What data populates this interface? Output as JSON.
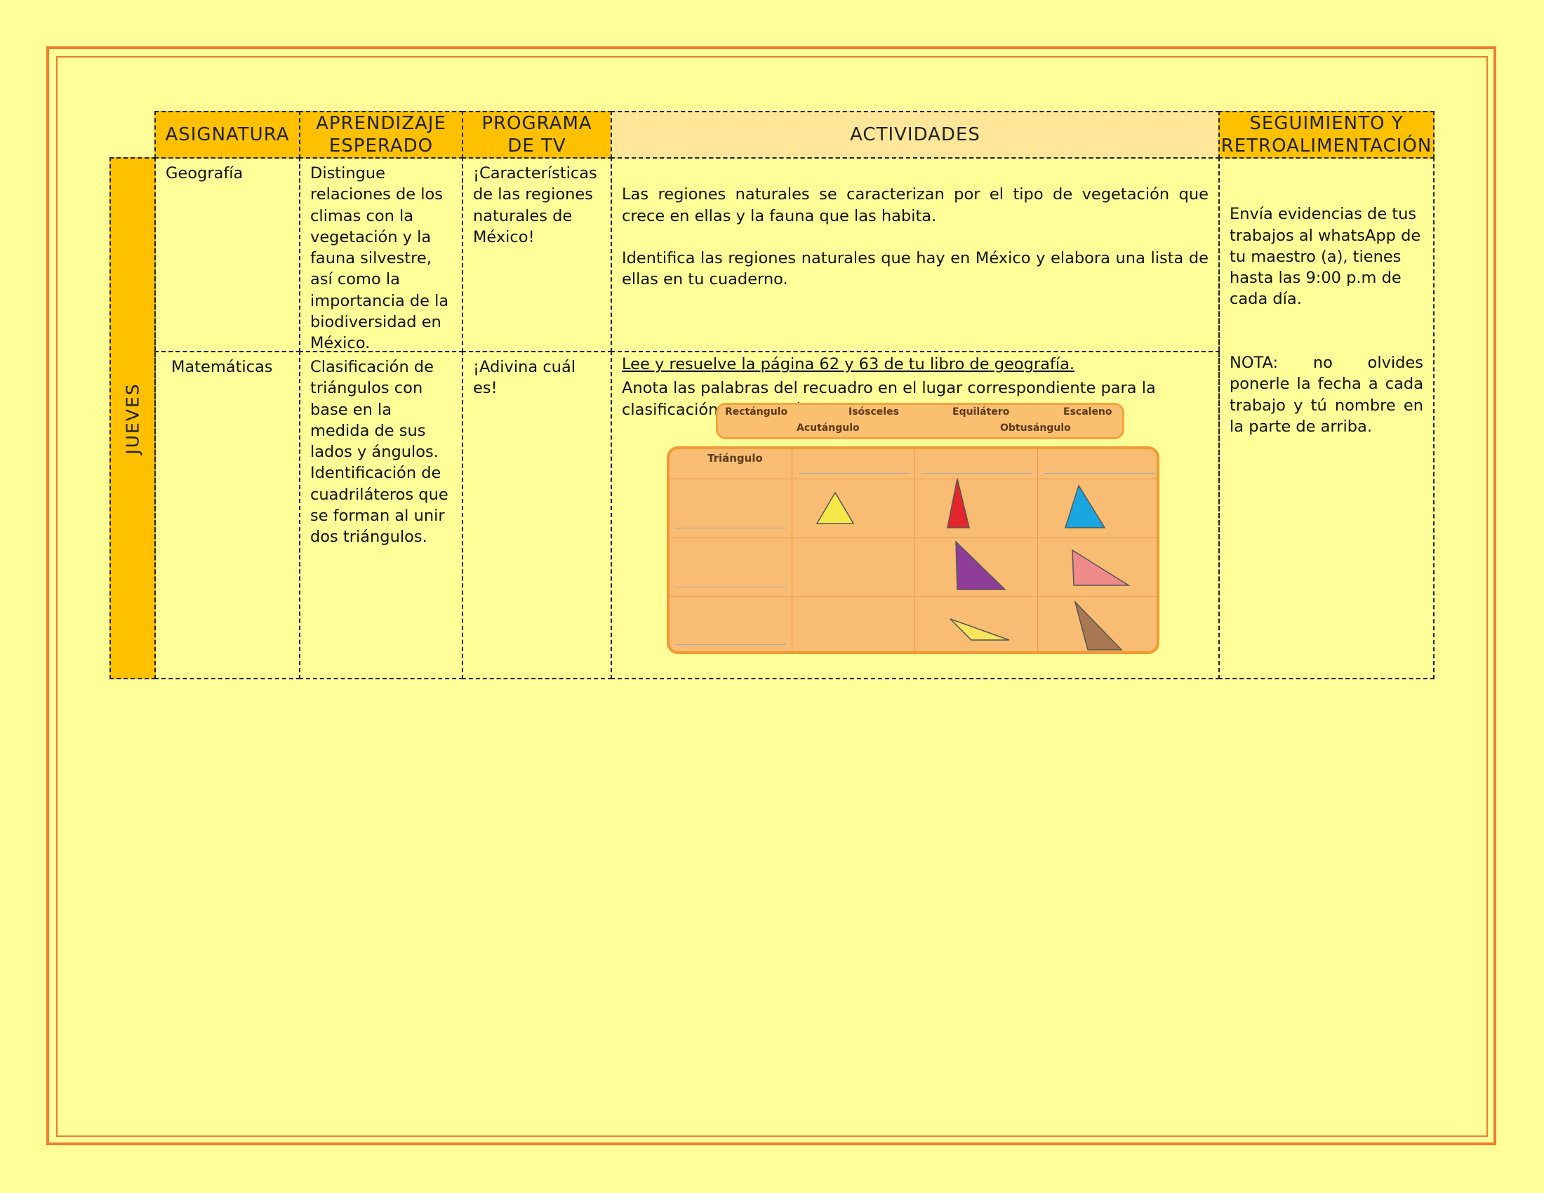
{
  "headers": {
    "asignatura": "ASIGNATURA",
    "aprendizaje": "APRENDIZAJE\nESPERADO",
    "programa": "PROGRAMA\nDE TV",
    "actividades": "ACTIVIDADES",
    "seguimiento": "SEGUIMIENTO Y\nRETROALIMENTACIÓN"
  },
  "day": "JUEVES",
  "rows": [
    {
      "asignatura": "Geografía",
      "aprendizaje": "Distingue relaciones de los climas con la vegetación y la fauna silvestre, así como la importancia de la biodiversidad en México.",
      "programa": "¡Características de las regiones naturales de México!",
      "actividades": {
        "p1": "Las regiones naturales se caracterizan por el tipo de vegetación que crece en ellas y la fauna que las habita.",
        "p2": "Identifica las regiones naturales que hay en México y elabora una lista de ellas en tu cuaderno.",
        "p3": "Lee y resuelve la página 62 y 63 de tu libro de geografía."
      }
    },
    {
      "asignatura": "Matemáticas",
      "aprendizaje": "Clasificación de triángulos con base en la medida de sus lados y ángulos. Identificación de cuadriláteros que se forman al unir dos triángulos.",
      "programa": "¡Adivina cuál es!",
      "actividades": {
        "p1": "Anota las palabras del recuadro en el lugar correspondiente para la clasificación de los triángulos."
      }
    }
  ],
  "seguimiento": {
    "p1": "Envía evidencias de tus trabajos al whatsApp de tu maestro (a), tienes hasta las 9:00 p.m de cada día.",
    "p2": "NOTA: no olvides ponerle la fecha a cada trabajo y tú nombre en la parte de arriba."
  },
  "triangle_exercise": {
    "words": [
      "Rectángulo",
      "Isósceles",
      "Equilátero",
      "Escaleno",
      "Acutángulo",
      "Obtusángulo"
    ],
    "table_label": "Triángulo",
    "colors": {
      "yellow": "#f7e84a",
      "red": "#e3262b",
      "blue": "#1aa6e0",
      "purple": "#8e3d98",
      "pink": "#ee8a8a",
      "light_yellow": "#f6e45a",
      "brown": "#a87852"
    }
  }
}
